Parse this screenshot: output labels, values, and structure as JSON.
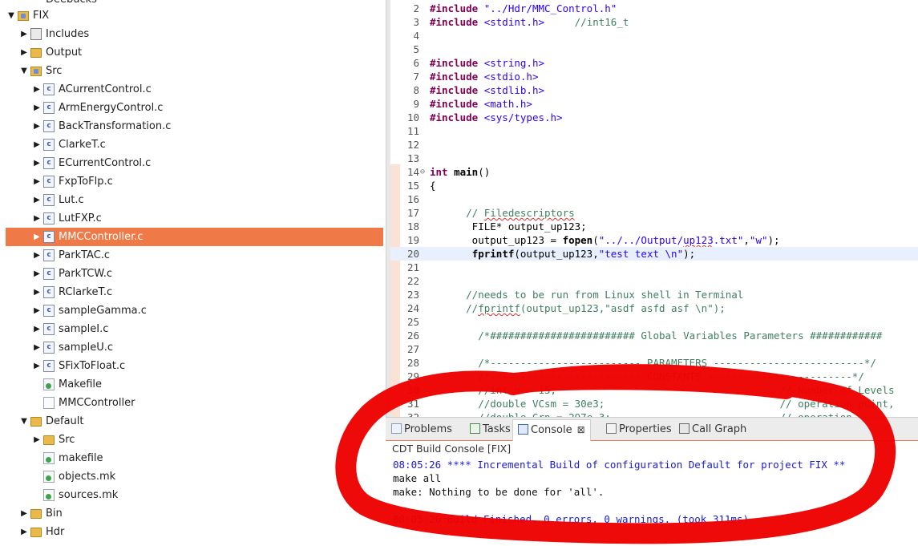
{
  "explorer": {
    "top_partial": "Deebucks",
    "rows": [
      {
        "label": "FIX",
        "twisty": "open",
        "icon": "project",
        "indent": 1
      },
      {
        "label": "Includes",
        "twisty": "closed",
        "icon": "includes",
        "indent": 2
      },
      {
        "label": "Output",
        "twisty": "closed",
        "icon": "folder",
        "indent": 2
      },
      {
        "label": "Src",
        "twisty": "open",
        "icon": "folder-src",
        "indent": 2
      },
      {
        "label": "ACurrentControl.c",
        "twisty": "closed",
        "icon": "c-file",
        "indent": 3
      },
      {
        "label": "ArmEnergyControl.c",
        "twisty": "closed",
        "icon": "c-file",
        "indent": 3
      },
      {
        "label": "BackTransformation.c",
        "twisty": "closed",
        "icon": "c-file",
        "indent": 3
      },
      {
        "label": "ClarkeT.c",
        "twisty": "closed",
        "icon": "c-file",
        "indent": 3
      },
      {
        "label": "ECurrentControl.c",
        "twisty": "closed",
        "icon": "c-file",
        "indent": 3
      },
      {
        "label": "FxpToFlp.c",
        "twisty": "closed",
        "icon": "c-file",
        "indent": 3
      },
      {
        "label": "Lut.c",
        "twisty": "closed",
        "icon": "c-file",
        "indent": 3
      },
      {
        "label": "LutFXP.c",
        "twisty": "closed",
        "icon": "c-file",
        "indent": 3
      },
      {
        "label": "MMCController.c",
        "twisty": "closed",
        "icon": "c-file",
        "indent": 3,
        "selected": true
      },
      {
        "label": "ParkTAC.c",
        "twisty": "closed",
        "icon": "c-file",
        "indent": 3
      },
      {
        "label": "ParkTCW.c",
        "twisty": "closed",
        "icon": "c-file",
        "indent": 3
      },
      {
        "label": "RClarkeT.c",
        "twisty": "closed",
        "icon": "c-file",
        "indent": 3
      },
      {
        "label": "sampleGamma.c",
        "twisty": "closed",
        "icon": "c-file",
        "indent": 3
      },
      {
        "label": "sampleI.c",
        "twisty": "closed",
        "icon": "c-file",
        "indent": 3
      },
      {
        "label": "sampleU.c",
        "twisty": "closed",
        "icon": "c-file",
        "indent": 3
      },
      {
        "label": "SFixToFloat.c",
        "twisty": "closed",
        "icon": "c-file",
        "indent": 3
      },
      {
        "label": "Makefile",
        "twisty": "none",
        "icon": "makefile",
        "indent": 3
      },
      {
        "label": "MMCController",
        "twisty": "none",
        "icon": "file",
        "indent": 3
      },
      {
        "label": "Default",
        "twisty": "open",
        "icon": "folder",
        "indent": 2
      },
      {
        "label": "Src",
        "twisty": "closed",
        "icon": "folder",
        "indent": 3
      },
      {
        "label": "makefile",
        "twisty": "none",
        "icon": "makefile",
        "indent": 3
      },
      {
        "label": "objects.mk",
        "twisty": "none",
        "icon": "makefile",
        "indent": 3
      },
      {
        "label": "sources.mk",
        "twisty": "none",
        "icon": "makefile",
        "indent": 3
      },
      {
        "label": "Bin",
        "twisty": "closed",
        "icon": "folder",
        "indent": 2
      },
      {
        "label": "Hdr",
        "twisty": "closed",
        "icon": "folder",
        "indent": 2
      }
    ]
  },
  "editor": {
    "lines": [
      {
        "n": "2",
        "parts": [
          [
            "kw",
            "#include "
          ],
          [
            "str",
            "\"../Hdr/MMC_Control.h\""
          ]
        ]
      },
      {
        "n": "3",
        "parts": [
          [
            "kw",
            "#include "
          ],
          [
            "str",
            "<stdint.h>"
          ],
          [
            "plain",
            "     "
          ],
          [
            "cmt",
            "//int16_t"
          ]
        ]
      },
      {
        "n": "4",
        "parts": []
      },
      {
        "n": "5",
        "parts": []
      },
      {
        "n": "6",
        "parts": [
          [
            "kw",
            "#include "
          ],
          [
            "str",
            "<string.h>"
          ]
        ]
      },
      {
        "n": "7",
        "parts": [
          [
            "kw",
            "#include "
          ],
          [
            "str",
            "<stdio.h>"
          ]
        ]
      },
      {
        "n": "8",
        "parts": [
          [
            "kw",
            "#include "
          ],
          [
            "str",
            "<stdlib.h>"
          ]
        ]
      },
      {
        "n": "9",
        "parts": [
          [
            "kw",
            "#include "
          ],
          [
            "str",
            "<math.h>"
          ]
        ]
      },
      {
        "n": "10",
        "parts": [
          [
            "kw",
            "#include "
          ],
          [
            "str",
            "<sys/types.h>"
          ]
        ]
      },
      {
        "n": "11",
        "parts": []
      },
      {
        "n": "12",
        "parts": []
      },
      {
        "n": "13",
        "parts": []
      },
      {
        "n": "14",
        "fold": "⊖",
        "parts": [
          [
            "kw",
            "int "
          ],
          [
            "fn",
            "main"
          ],
          [
            "plain",
            "()"
          ]
        ]
      },
      {
        "n": "15",
        "parts": [
          [
            "plain",
            "{"
          ]
        ]
      },
      {
        "n": "16",
        "parts": []
      },
      {
        "n": "17",
        "parts": [
          [
            "plain",
            "      "
          ],
          [
            "cmt",
            "// "
          ],
          [
            "cmtsq",
            "Filedescriptors"
          ]
        ]
      },
      {
        "n": "18",
        "parts": [
          [
            "plain",
            "       FILE* output_up123;"
          ]
        ]
      },
      {
        "n": "19",
        "parts": [
          [
            "plain",
            "       output_up123 = "
          ],
          [
            "fn",
            "fopen"
          ],
          [
            "plain",
            "("
          ],
          [
            "str",
            "\"../../Output/"
          ],
          [
            "strsq",
            "up123"
          ],
          [
            "str",
            ".txt\""
          ],
          [
            "plain",
            ","
          ],
          [
            "str",
            "\"w\""
          ],
          [
            "plain",
            ");"
          ]
        ]
      },
      {
        "n": "20",
        "current": true,
        "parts": [
          [
            "plain",
            "       "
          ],
          [
            "fn",
            "fprintf"
          ],
          [
            "plain",
            "(output_up123,"
          ],
          [
            "str",
            "\"test text \\n\""
          ],
          [
            "plain",
            ");"
          ]
        ]
      },
      {
        "n": "21",
        "parts": []
      },
      {
        "n": "22",
        "parts": []
      },
      {
        "n": "23",
        "parts": [
          [
            "plain",
            "      "
          ],
          [
            "cmt",
            "//needs to be run from Linux shell in Terminal"
          ]
        ]
      },
      {
        "n": "24",
        "parts": [
          [
            "plain",
            "      "
          ],
          [
            "cmt",
            "//"
          ],
          [
            "cmtsq",
            "fprintf"
          ],
          [
            "cmt",
            "(output_up123,\"asdf asfd asf \\n\");"
          ]
        ]
      },
      {
        "n": "25",
        "parts": []
      },
      {
        "n": "26",
        "parts": [
          [
            "plain",
            "        "
          ],
          [
            "cmt",
            "/*######################## Global Variables Parameters ############"
          ]
        ]
      },
      {
        "n": "27",
        "parts": []
      },
      {
        "n": "28",
        "parts": [
          [
            "plain",
            "        "
          ],
          [
            "cmt",
            "/*------------------------- PARAMETERS -------------------------*/"
          ]
        ]
      },
      {
        "n": "29",
        "parts": [
          [
            "plain",
            "        "
          ],
          [
            "cmt",
            "/*------------------------- CONSTANTS ------------------------*/"
          ]
        ]
      },
      {
        "n": "30",
        "parts": [
          [
            "plain",
            "        "
          ],
          [
            "cmt",
            "//int n = 15;                                     // Number of Levels"
          ]
        ]
      },
      {
        "n": "31",
        "parts": [
          [
            "plain",
            "        "
          ],
          [
            "cmt",
            "//double VCsm = 30e3;                             // operation point,"
          ]
        ]
      },
      {
        "n": "32",
        "parts": [
          [
            "plain",
            "        "
          ],
          [
            "cmt",
            "//double Grn = 297e-3;                            // operation"
          ]
        ]
      }
    ]
  },
  "bottom": {
    "tabs": [
      {
        "label": "Problems",
        "icon": "problems-icon"
      },
      {
        "label": "Tasks",
        "icon": "tasks-icon"
      },
      {
        "label": "Console",
        "icon": "console-icon",
        "active": true,
        "close": "⊠"
      },
      {
        "label": "Properties",
        "icon": "properties-icon"
      },
      {
        "label": "Call Graph",
        "icon": "call-graph-icon"
      }
    ],
    "console_title": "CDT Build Console [FIX]",
    "console_lines": [
      {
        "text": "08:05:26 **** Incremental Build of configuration Default for project FIX **",
        "color": "blue"
      },
      {
        "text": "make all",
        "color": "black"
      },
      {
        "text": "make: Nothing to be done for 'all'.",
        "color": "black"
      },
      {
        "text": "",
        "color": "black"
      },
      {
        "text": "08:05:26 Build Finished. 0 errors, 0 warnings. (took 311ms)",
        "color": "blue"
      }
    ]
  },
  "colors": {
    "selection": "#f07a47",
    "annotation": "#ee0000",
    "keyword": "#7f0055",
    "string": "#2a00ff",
    "comment": "#3f7f5f",
    "console_blue": "#1a1adc"
  }
}
